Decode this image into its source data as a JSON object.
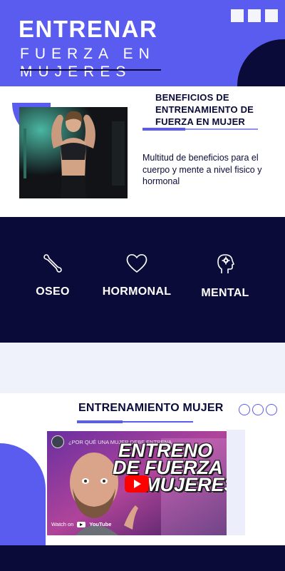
{
  "hero": {
    "title": "ENTRENAR",
    "subtitle": "FUERZA EN MUJERES"
  },
  "benefits": {
    "title": "BENEFICIOS DE ENTRENAMIENTO DE FUERZA EN MUJER",
    "text": "Multitud de beneficios para el cuerpo y mente a nivel fisico y hormonal"
  },
  "features": [
    {
      "label": "OSEO",
      "icon": "bone-icon"
    },
    {
      "label": "HORMONAL",
      "icon": "heart-icon"
    },
    {
      "label": "MENTAL",
      "icon": "head-gear-icon"
    }
  ],
  "training": {
    "title": "ENTRENAMIENTO MUJER"
  },
  "video": {
    "title": "¿POR QUÉ UNA MUJER DEBE ENTRENA...",
    "overlay_line1": "ENTRENO",
    "overlay_line2": "DE FUERZA",
    "overlay_line3": "MUJERES",
    "watch_on": "Watch on",
    "platform": "YouTube"
  },
  "colors": {
    "accent": "#5a5cf0",
    "navy": "#0b0b3a",
    "light": "#f0f2fb"
  }
}
